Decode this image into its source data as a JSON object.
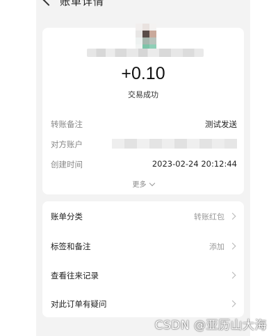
{
  "header": {
    "title": "账单详情"
  },
  "transaction": {
    "amount": "+0.10",
    "status": "交易成功"
  },
  "details": {
    "rows": [
      {
        "label": "转账备注",
        "value": "测试发送"
      },
      {
        "label": "对方账户",
        "value": ""
      },
      {
        "label": "创建时间",
        "value": "2023-02-24 20:12:44"
      }
    ],
    "more_label": "更多"
  },
  "menu": [
    {
      "label": "账单分类",
      "value": "转账红包"
    },
    {
      "label": "标签和备注",
      "value": "添加"
    },
    {
      "label": "查看往来记录",
      "value": ""
    },
    {
      "label": "对此订单有疑问",
      "value": ""
    }
  ],
  "watermark": {
    "text": "CSDN @亚历山大海"
  },
  "colors": {
    "background": "#f3f3f3",
    "card": "#ffffff",
    "label_gray": "#888888",
    "value_dark": "#222222"
  }
}
